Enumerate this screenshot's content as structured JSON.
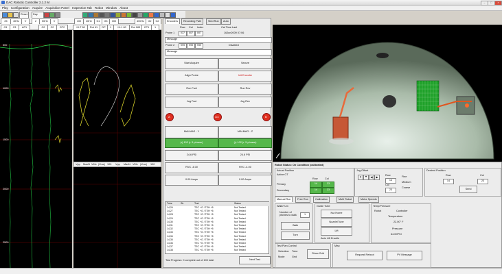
{
  "window": {
    "title": "DAC Robotic Controller 2.1.2 M"
  },
  "menu": [
    "Play",
    "Configuration",
    "Acquire",
    "Acquisition Panel",
    "Inspection Tab",
    "Robot",
    "Window",
    "About"
  ],
  "toolbar": {
    "btn1": "Reset",
    "btn2": "Day"
  },
  "channels_row1": [
    "25",
    "40Hz",
    "V",
    "2",
    "50Hz",
    "V",
    "100",
    "40Hz",
    "G1",
    "G3",
    "300",
    "400Hz",
    "G2",
    "G2"
  ],
  "channels_row2": [
    "G1",
    "C3",
    "AP1",
    "G2",
    "C2",
    "CP2",
    "+H:T 80",
    "Rot 61",
    "DP",
    "1",
    "+H:1 80",
    "Rot 183",
    "CP1",
    "1"
  ],
  "strip_labels": [
    "500",
    "1000",
    "1500",
    "2000",
    "2500"
  ],
  "lissajous_rows": [
    "Vpp",
    "MaxN",
    "VMx",
    "|Vme|",
    "100",
    "Vpp",
    "MaxN",
    "VMx",
    "|Vme|",
    "100"
  ],
  "tabs_top": [
    "Encoders",
    "Recording Path",
    "Sled Run",
    "Auto"
  ],
  "probe1": {
    "label": "Probe 1",
    "row": "037",
    "col": "007",
    "index": "007",
    "time": "16Jun2009 07:06",
    "headers": [
      "Row",
      "Col",
      "Index",
      "Cal Time Last"
    ]
  },
  "message1": "Message",
  "probe2": {
    "label": "Probe 2",
    "row": "999",
    "col": "999",
    "index": "999",
    "status": "Disabled"
  },
  "message2": "Message",
  "controls": {
    "start_acquire": "Start Acquire",
    "secure": "Secure",
    "align_probe": "Align Probe",
    "init_encoder": "Init Encoder",
    "run_fwd": "Run Fwd",
    "run_rev": "Run Rev",
    "jog_fwd": "Jog Fwd",
    "jog_rev": "Jog Rev",
    "a_label": "A",
    "off_label": "OFF",
    "b_label": "B"
  },
  "manifold": {
    "left": "MALMAG - Y",
    "right": "MALMAG - Z",
    "left_status": "(r) 102 (r. 5 phrase)",
    "right_status": "(r) 102 (r. 5 phrase)"
  },
  "psi": {
    "left": "24.6 PSI",
    "right": "24.6 PSI"
  },
  "valve": {
    "left": "RVC -4.00",
    "right": "RVC -4.00"
  },
  "amps": {
    "left": "0.00 Amps",
    "right": "0.00 Amps"
  },
  "table": {
    "headers": [
      "Tube",
      "Str",
      "Test",
      "Status"
    ],
    "rows": [
      [
        "14,26",
        "",
        "TEC +G / TEH +5",
        "Not Tested"
      ],
      [
        "14,27",
        "",
        "TEC +G / TEH +5",
        "Not Tested"
      ],
      [
        "14,28",
        "",
        "TEC +G / TEH +5",
        "Not Tested"
      ],
      [
        "14,29",
        "",
        "TEC +G / TEH +5",
        "Not Tested"
      ],
      [
        "14,30",
        "",
        "TEC +G / TEH +5",
        "Not Tested"
      ],
      [
        "14,31",
        "",
        "TEC +G / TEH +5",
        "Not Tested"
      ],
      [
        "14,32",
        "",
        "TEC +G / TEH +5",
        "Not Tested"
      ],
      [
        "14,33",
        "",
        "TEC +G / TEH +5",
        "Not Tested"
      ],
      [
        "14,34",
        "",
        "TEC +G / TEH +5",
        "Not Tested"
      ],
      [
        "14,35",
        "",
        "TEC +G / TEH +5",
        "Not Tested"
      ],
      [
        "14,36",
        "",
        "TEC +G / TEH +5",
        "Not Tested"
      ],
      [
        "14,37",
        "",
        "TEC +G / TEH +5",
        "Not Tested"
      ],
      [
        "14,38",
        "",
        "TEC +G / TEH +5",
        "Not Tested"
      ]
    ],
    "progress": "Test Progress: 0 complete out of 100 total",
    "next_test": "Next Test"
  },
  "robot_status": "Robot Status: On Condition (calibrated)",
  "actual_position": {
    "title": "Actual Position",
    "active_gt": "Active GT",
    "row_label": "Row",
    "col_label": "Col",
    "primary": "Primary",
    "secondary": "Secondary",
    "p_row": "14",
    "p_col": "23",
    "s_row": "14",
    "s_col": "23"
  },
  "jog_offset": {
    "title": "Jog Offset",
    "row": "Row",
    "col": "Col",
    "row_val": "14",
    "col_val": "23",
    "fine": "Fine",
    "medium": "Medium",
    "coarse": "Coarse"
  },
  "desired_position": {
    "title": "Desired Position",
    "row": "Row",
    "col": "Col",
    "row_val": "14",
    "col_val": "23",
    "send": "Send"
  },
  "lower_tabs": [
    "Manual Run",
    "Free Run",
    "Calibration",
    "Multi Robot",
    "Motor Speeds"
  ],
  "walk": {
    "title": "Walk/Turn",
    "steps_label": "Number of pitches to walk",
    "steps_val": "1",
    "walk": "Walk",
    "turn": "Turn"
  },
  "guide_tube": {
    "title": "Guide Tube",
    "nut_home": "Nut Home",
    "nozzle_tube": "Nozzle/Tube",
    "lift": "Lift",
    "auto_lift": "Auto Lift Enable"
  },
  "temp_pressure": {
    "title": "Temp/Pressure",
    "robot": "Robot",
    "controller": "Controller",
    "temperature": "Temperature",
    "temp_val": "22.00° F",
    "pressure": "Pressure",
    "pressure_val": "64.00PSI"
  },
  "test_plan": {
    "title": "Test Plan Control",
    "selection": "Selection",
    "tube": "Tube",
    "mode": "Mode",
    "grid": "Grid",
    "show_grid": "Show Grid"
  },
  "misc": {
    "title": "Misc",
    "request_reboot": "Request Reboot",
    "pv_message": "PV Message"
  },
  "colors": {
    "green": "#56b84b",
    "red": "#e03020",
    "trace_green": "#29c23a"
  }
}
